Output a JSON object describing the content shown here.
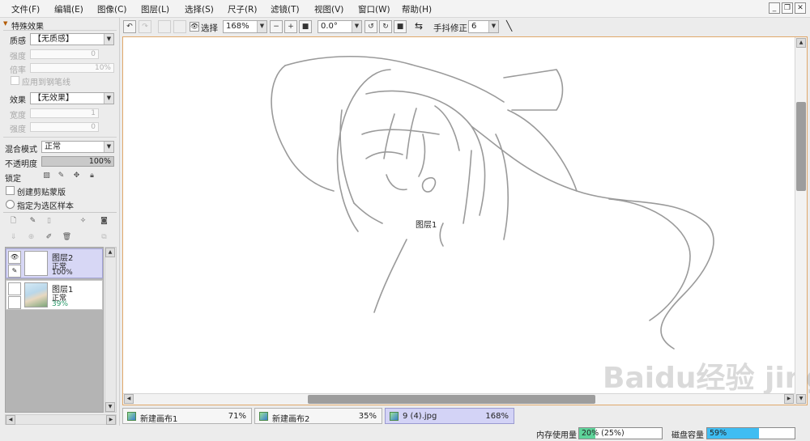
{
  "menubar": {
    "items": [
      "文件(F)",
      "编辑(E)",
      "图像(C)",
      "图层(L)",
      "选择(S)",
      "尺子(R)",
      "滤镜(T)",
      "视图(V)",
      "窗口(W)",
      "帮助(H)"
    ],
    "window_buttons": [
      "_",
      "❐",
      "✕"
    ]
  },
  "left_panel": {
    "section_title": "特殊效果",
    "texture_label": "质感",
    "texture_value": "【无质感】",
    "strength_label": "强度",
    "strength_value": "0",
    "ratio_label": "倍率",
    "ratio_value": "10%",
    "apply_pen_label": "应用到钢笔线",
    "effect_label": "效果",
    "effect_value": "【无效果】",
    "width_label": "宽度",
    "width_value": "1",
    "effect_strength_label": "强度",
    "effect_strength_value": "0",
    "blend_label": "混合模式",
    "blend_value": "正常",
    "opacity_label": "不透明度",
    "opacity_value": "100%",
    "lock_label": "锁定",
    "clip_label": "创建剪贴蒙版",
    "sample_label": "指定为选区样本"
  },
  "layers": [
    {
      "name": "图层2",
      "mode": "正常",
      "opacity": "100%",
      "selected": true,
      "visible": true
    },
    {
      "name": "图层1",
      "mode": "正常",
      "opacity": "39%",
      "selected": false,
      "visible": false
    }
  ],
  "canvas_toolbar": {
    "select_label": "选择",
    "zoom_value": "168%",
    "rotation_value": "0.0°",
    "stabilizer_label": "手抖修正",
    "stabilizer_value": "6"
  },
  "canvas": {
    "hover_label": "图层1"
  },
  "doc_tabs": [
    {
      "name": "新建画布1",
      "zoom": "71%",
      "active": false
    },
    {
      "name": "新建画布2",
      "zoom": "35%",
      "active": false
    },
    {
      "name": "9 (4).jpg",
      "zoom": "168%",
      "active": true
    }
  ],
  "status": {
    "memory_label": "内存使用量",
    "memory_text": "20% (25%)",
    "memory_fraction": 0.2,
    "disk_label": "磁盘容量",
    "disk_text": "59%",
    "disk_fraction": 0.59
  },
  "colors": {
    "accent_canvas_border": "#e0a86a",
    "selected_layer": "#d7d7f5",
    "memory_fill": "#5ed49a",
    "disk_fill": "#3fbdf2"
  },
  "watermark": "Baidu经验 jingyan.baidu.com"
}
